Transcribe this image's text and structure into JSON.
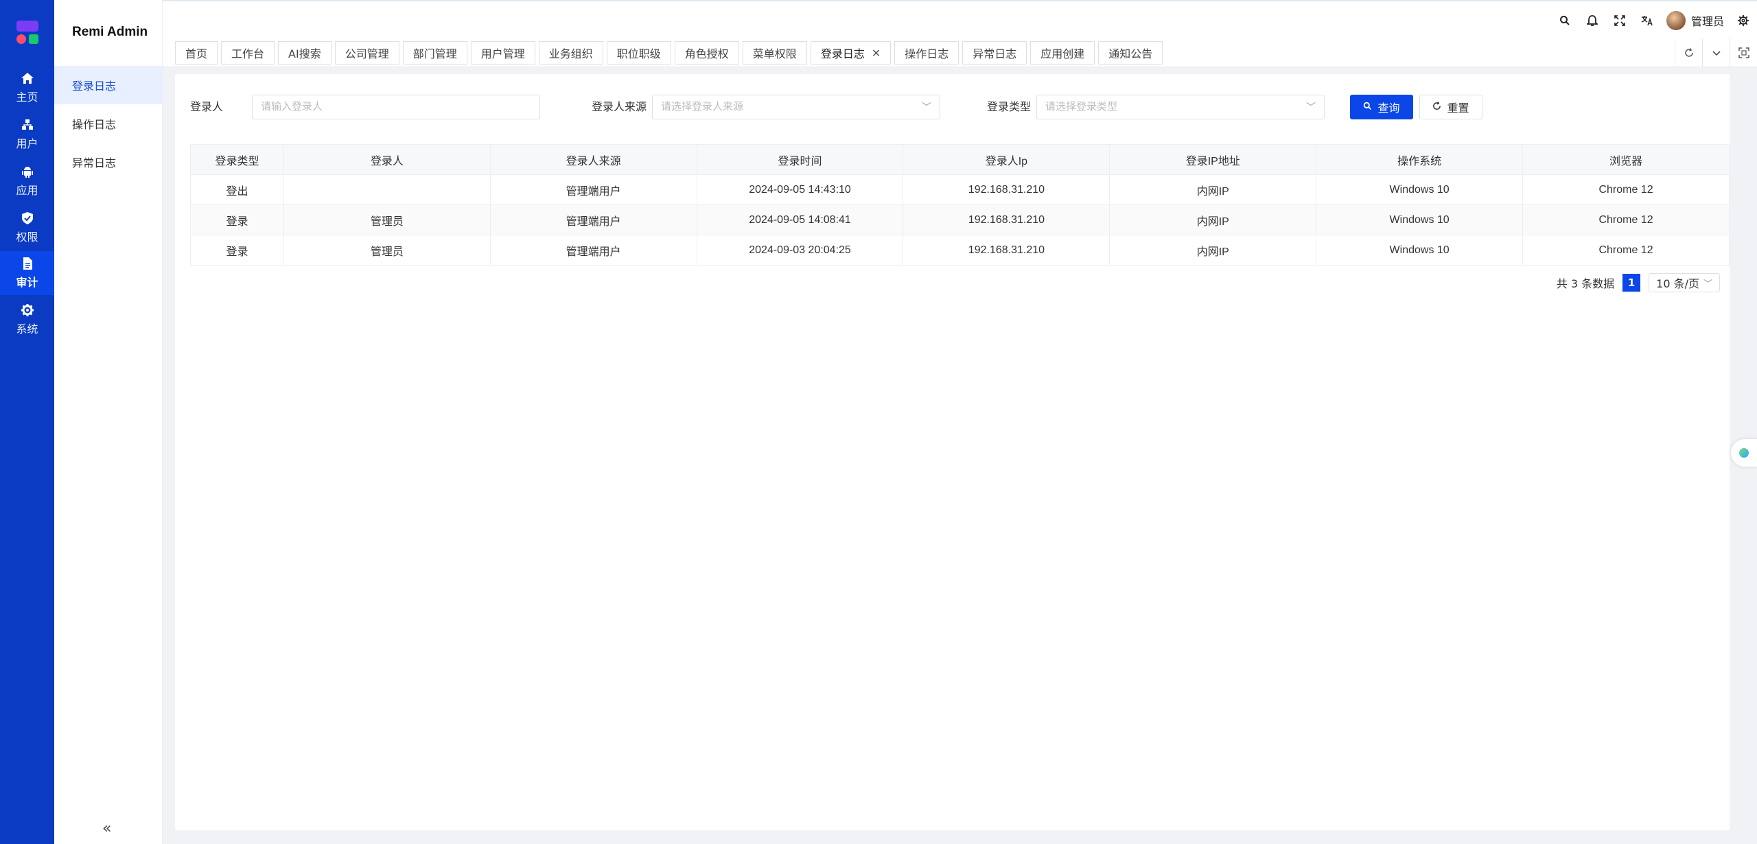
{
  "brand": "Remi Admin",
  "rail": [
    {
      "label": "主页",
      "icon": "home-icon"
    },
    {
      "label": "用户",
      "icon": "users-icon"
    },
    {
      "label": "应用",
      "icon": "android-icon"
    },
    {
      "label": "权限",
      "icon": "shield-icon"
    },
    {
      "label": "审计",
      "icon": "document-icon",
      "active": true
    },
    {
      "label": "系统",
      "icon": "gear-icon"
    }
  ],
  "subnav": [
    "登录日志",
    "操作日志",
    "异常日志"
  ],
  "header": {
    "user": "管理员"
  },
  "tabs": [
    "首页",
    "工作台",
    "AI搜索",
    "公司管理",
    "部门管理",
    "用户管理",
    "业务组织",
    "职位职级",
    "角色授权",
    "菜单权限",
    "登录日志",
    "操作日志",
    "异常日志",
    "应用创建",
    "通知公告"
  ],
  "active_tab": "登录日志",
  "filters": {
    "user_label": "登录人",
    "user_placeholder": "请输入登录人",
    "source_label": "登录人来源",
    "source_placeholder": "请选择登录人来源",
    "type_label": "登录类型",
    "type_placeholder": "请选择登录类型",
    "search_btn": "查询",
    "reset_btn": "重置"
  },
  "table": {
    "columns": [
      "登录类型",
      "登录人",
      "登录人来源",
      "登录时间",
      "登录人Ip",
      "登录IP地址",
      "操作系统",
      "浏览器"
    ],
    "rows": [
      [
        "登出",
        "",
        "管理端用户",
        "2024-09-05 14:43:10",
        "192.168.31.210",
        "内网IP",
        "Windows 10",
        "Chrome 12"
      ],
      [
        "登录",
        "管理员",
        "管理端用户",
        "2024-09-05 14:08:41",
        "192.168.31.210",
        "内网IP",
        "Windows 10",
        "Chrome 12"
      ],
      [
        "登录",
        "管理员",
        "管理端用户",
        "2024-09-03 20:04:25",
        "192.168.31.210",
        "内网IP",
        "Windows 10",
        "Chrome 12"
      ]
    ]
  },
  "pager": {
    "total": "共 3 条数据",
    "page": "1",
    "size": "10 条/页"
  },
  "colors": {
    "primary": "#0b47e8",
    "rail": "#0a3bc2"
  }
}
